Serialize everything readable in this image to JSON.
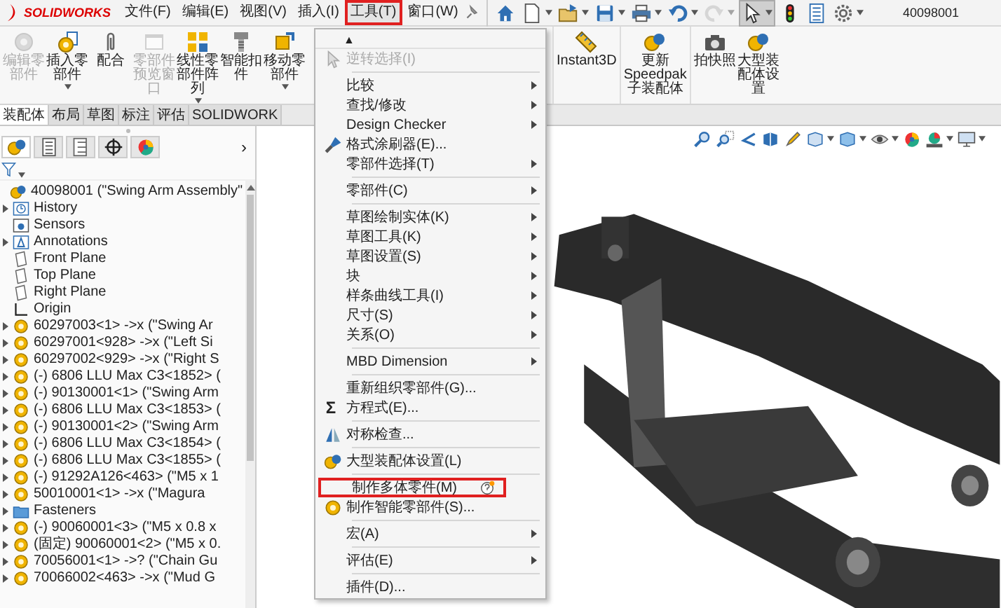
{
  "app": {
    "logo": "SOLIDWORKS",
    "title": "40098001"
  },
  "menubar": [
    {
      "label": "文件(F)",
      "selected": false
    },
    {
      "label": "编辑(E)",
      "selected": false
    },
    {
      "label": "视图(V)",
      "selected": false
    },
    {
      "label": "插入(I)",
      "selected": false
    },
    {
      "label": "工具(T)",
      "selected": true
    },
    {
      "label": "窗口(W)",
      "selected": false
    }
  ],
  "toolbar": [
    {
      "kind": "home",
      "dropdown": false,
      "pressed": false,
      "disabled": false
    },
    {
      "kind": "new",
      "dropdown": true,
      "pressed": false,
      "disabled": false
    },
    {
      "kind": "open",
      "dropdown": true,
      "pressed": false,
      "disabled": false
    },
    {
      "kind": "save",
      "dropdown": true,
      "pressed": false,
      "disabled": false
    },
    {
      "kind": "print",
      "dropdown": true,
      "pressed": false,
      "disabled": false
    },
    {
      "kind": "undo",
      "dropdown": true,
      "pressed": false,
      "disabled": false
    },
    {
      "kind": "redo",
      "dropdown": true,
      "pressed": false,
      "disabled": true
    },
    {
      "kind": "select",
      "dropdown": true,
      "pressed": true,
      "disabled": false
    },
    {
      "kind": "traffic-light",
      "dropdown": false,
      "pressed": false,
      "disabled": false
    },
    {
      "kind": "list",
      "dropdown": false,
      "pressed": false,
      "disabled": false
    },
    {
      "kind": "gear",
      "dropdown": true,
      "pressed": false,
      "disabled": false
    }
  ],
  "ribbon": {
    "groups": [
      {
        "buttons": [
          {
            "kind": "edit-part",
            "label": "编辑零部件",
            "disabled": true,
            "dropdown": false
          },
          {
            "kind": "insert-part",
            "label": "插入零部件",
            "disabled": false,
            "dropdown": true
          },
          {
            "kind": "mate",
            "label": "配合",
            "disabled": false,
            "dropdown": false
          },
          {
            "kind": "preview",
            "label": "零部件预览窗口",
            "disabled": true,
            "dropdown": false
          },
          {
            "kind": "pattern",
            "label": "线性零部件阵列",
            "disabled": false,
            "dropdown": true
          },
          {
            "kind": "fastener",
            "label": "智能扣件",
            "disabled": false,
            "dropdown": false
          },
          {
            "kind": "move",
            "label": "移动零部件",
            "disabled": false,
            "dropdown": true
          }
        ]
      },
      {
        "buttons": [
          {
            "kind": "instant3d",
            "label": "Instant3D",
            "disabled": false,
            "dropdown": false
          }
        ]
      },
      {
        "buttons": [
          {
            "kind": "speedpak",
            "label": "更新Speedpak子装配体",
            "disabled": false,
            "dropdown": false
          }
        ]
      },
      {
        "buttons": [
          {
            "kind": "camera",
            "label": "拍快照",
            "disabled": false,
            "dropdown": false
          },
          {
            "kind": "large",
            "label": "大型装配体设置",
            "disabled": false,
            "dropdown": false
          }
        ]
      }
    ]
  },
  "command_tabs": [
    {
      "label": "装配体",
      "selected": true
    },
    {
      "label": "布局",
      "selected": false
    },
    {
      "label": "草图",
      "selected": false
    },
    {
      "label": "标注",
      "selected": false
    },
    {
      "label": "评估",
      "selected": false
    },
    {
      "label": "SOLIDWORK",
      "selected": false
    }
  ],
  "panel": {
    "tabs": [
      {
        "kind": "feature",
        "selected": true
      },
      {
        "kind": "property",
        "selected": false
      },
      {
        "kind": "config",
        "selected": false
      },
      {
        "kind": "dimxpert",
        "selected": false
      },
      {
        "kind": "display",
        "selected": false
      }
    ],
    "more_tabs": "›",
    "tree": {
      "kind": "assembly",
      "label": "40098001 (\"Swing Arm Assembly\"",
      "expander": false,
      "children": [
        {
          "kind": "history",
          "label": "History",
          "expander": true
        },
        {
          "kind": "sensors",
          "label": "Sensors",
          "expander": false
        },
        {
          "kind": "annotations",
          "label": "Annotations",
          "expander": true
        },
        {
          "kind": "plane",
          "label": "Front Plane",
          "expander": false
        },
        {
          "kind": "plane",
          "label": "Top Plane",
          "expander": false
        },
        {
          "kind": "plane",
          "label": "Right Plane",
          "expander": false
        },
        {
          "kind": "origin",
          "label": "Origin",
          "expander": false
        },
        {
          "kind": "part",
          "label": "60297003<1> ->x (\"Swing Ar",
          "expander": true
        },
        {
          "kind": "part",
          "label": "60297001<928> ->x (\"Left Si",
          "expander": true
        },
        {
          "kind": "part",
          "label": "60297002<929> ->x (\"Right S",
          "expander": true
        },
        {
          "kind": "part",
          "label": "(-) 6806 LLU Max C3<1852> (",
          "expander": true
        },
        {
          "kind": "part",
          "label": "(-) 90130001<1> (\"Swing Arm",
          "expander": true
        },
        {
          "kind": "part",
          "label": "(-) 6806 LLU Max C3<1853> (",
          "expander": true
        },
        {
          "kind": "part",
          "label": "(-) 90130001<2> (\"Swing Arm",
          "expander": true
        },
        {
          "kind": "part",
          "label": "(-) 6806 LLU Max C3<1854> (",
          "expander": true
        },
        {
          "kind": "part",
          "label": "(-) 6806 LLU Max C3<1855> (",
          "expander": true
        },
        {
          "kind": "part",
          "label": "(-) 91292A126<463> (\"M5 x 1",
          "expander": true
        },
        {
          "kind": "part",
          "label": "50010001<1> ->x (\"Magura",
          "expander": true
        },
        {
          "kind": "folder",
          "label": "Fasteners",
          "expander": true
        },
        {
          "kind": "part",
          "label": "(-) 90060001<3> (\"M5 x 0.8 x",
          "expander": true
        },
        {
          "kind": "part",
          "label": "(固定) 90060001<2> (\"M5 x 0.",
          "expander": true
        },
        {
          "kind": "part",
          "label": "70056001<1> ->? (\"Chain Gu",
          "expander": true
        },
        {
          "kind": "part",
          "label": "70066002<463> ->x (\"Mud G",
          "expander": true
        }
      ]
    }
  },
  "heads_up_toolbar": [
    {
      "kind": "zoom-fit",
      "dropdown": false
    },
    {
      "kind": "zoom-area",
      "dropdown": false
    },
    {
      "kind": "previous-view",
      "dropdown": false
    },
    {
      "kind": "section-view",
      "dropdown": false
    },
    {
      "kind": "annotation-view",
      "dropdown": false
    },
    {
      "kind": "view-orientation",
      "dropdown": true
    },
    {
      "kind": "display-style",
      "dropdown": true
    },
    {
      "kind": "hide-show",
      "dropdown": true
    },
    {
      "kind": "appearance",
      "dropdown": false
    },
    {
      "kind": "scene",
      "dropdown": true
    },
    {
      "kind": "view-settings",
      "dropdown": true
    }
  ],
  "tools_menu": {
    "items": [
      {
        "kind": "scroll-up",
        "label": "▲"
      },
      {
        "kind": "cursor",
        "label": "逆转选择(I)",
        "disabled": true,
        "submenu": false,
        "highlighted": false
      },
      {
        "kind": "separator"
      },
      {
        "kind": "item",
        "label": "比较",
        "disabled": false,
        "submenu": true,
        "highlighted": false
      },
      {
        "kind": "item",
        "label": "查找/修改",
        "disabled": false,
        "submenu": true,
        "highlighted": false
      },
      {
        "kind": "item",
        "label": "Design Checker",
        "disabled": false,
        "submenu": true,
        "highlighted": false
      },
      {
        "kind": "brush",
        "label": "格式涂刷器(E)...",
        "disabled": false,
        "submenu": false,
        "highlighted": false
      },
      {
        "kind": "item",
        "label": "零部件选择(T)",
        "disabled": false,
        "submenu": true,
        "highlighted": false
      },
      {
        "kind": "separator"
      },
      {
        "kind": "item",
        "label": "零部件(C)",
        "disabled": false,
        "submenu": true,
        "highlighted": false
      },
      {
        "kind": "separator"
      },
      {
        "kind": "item",
        "label": "草图绘制实体(K)",
        "disabled": false,
        "submenu": true,
        "highlighted": false
      },
      {
        "kind": "item",
        "label": "草图工具(K)",
        "disabled": false,
        "submenu": true,
        "highlighted": false
      },
      {
        "kind": "item",
        "label": "草图设置(S)",
        "disabled": false,
        "submenu": true,
        "highlighted": false
      },
      {
        "kind": "item",
        "label": "块",
        "disabled": false,
        "submenu": true,
        "highlighted": false
      },
      {
        "kind": "item",
        "label": "样条曲线工具(I)",
        "disabled": false,
        "submenu": true,
        "highlighted": false
      },
      {
        "kind": "item",
        "label": "尺寸(S)",
        "disabled": false,
        "submenu": true,
        "highlighted": false
      },
      {
        "kind": "item",
        "label": "关系(O)",
        "disabled": false,
        "submenu": true,
        "highlighted": false
      },
      {
        "kind": "separator"
      },
      {
        "kind": "item",
        "label": "MBD Dimension",
        "disabled": false,
        "submenu": true,
        "highlighted": false
      },
      {
        "kind": "separator"
      },
      {
        "kind": "item",
        "label": "重新组织零部件(G)...",
        "disabled": false,
        "submenu": false,
        "highlighted": false
      },
      {
        "kind": "equation",
        "label": "方程式(E)...",
        "icon_char": "Σ",
        "disabled": false,
        "submenu": false,
        "highlighted": false
      },
      {
        "kind": "separator"
      },
      {
        "kind": "symmetry",
        "label": "对称检查...",
        "disabled": false,
        "submenu": false,
        "highlighted": false
      },
      {
        "kind": "separator"
      },
      {
        "kind": "large-assembly",
        "label": "大型装配体设置(L)",
        "disabled": false,
        "submenu": false,
        "highlighted": false
      },
      {
        "kind": "separator"
      },
      {
        "kind": "help",
        "label": "制作多体零件(M)",
        "disabled": false,
        "submenu": false,
        "highlighted": true
      },
      {
        "kind": "smart-part",
        "label": "制作智能零部件(S)...",
        "disabled": false,
        "submenu": false,
        "highlighted": false
      },
      {
        "kind": "separator"
      },
      {
        "kind": "item",
        "label": "宏(A)",
        "disabled": false,
        "submenu": true,
        "highlighted": false
      },
      {
        "kind": "separator"
      },
      {
        "kind": "item",
        "label": "评估(E)",
        "disabled": false,
        "submenu": true,
        "highlighted": false
      },
      {
        "kind": "separator"
      },
      {
        "kind": "item",
        "label": "插件(D)...",
        "disabled": false,
        "submenu": false,
        "highlighted": false
      }
    ]
  }
}
